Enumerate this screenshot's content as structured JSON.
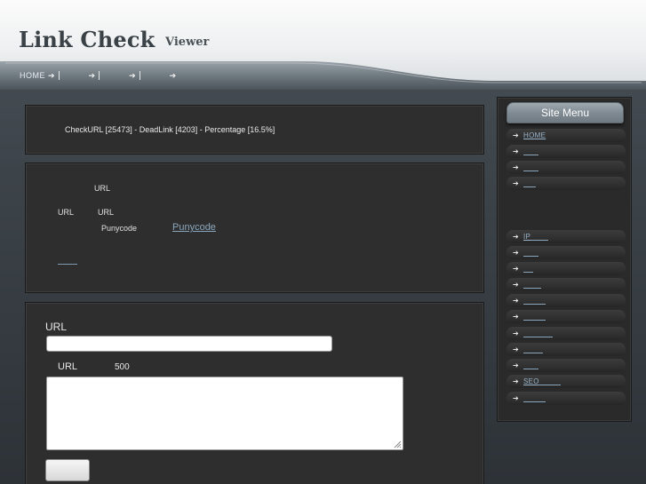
{
  "header": {
    "title": "Link Check",
    "subtitle": "Viewer"
  },
  "nav": {
    "items": [
      {
        "label": "HOME",
        "arrow": "➔"
      },
      {
        "label": "",
        "arrow": "➔"
      },
      {
        "label": "",
        "arrow": "➔"
      },
      {
        "label": "",
        "arrow": "➔"
      }
    ]
  },
  "stats": {
    "text": "CheckURL [25473] - DeadLink [4203] - Percentage [16.5%]"
  },
  "info": {
    "line1": "URL",
    "line2_a": "URL",
    "line2_b": "URL",
    "punycode_label": "Punycode",
    "punycode_link": "Punycode"
  },
  "form": {
    "url_label": "URL",
    "url_value": "",
    "list_label": "URL",
    "list_limit": "500",
    "list_value": "",
    "submit_label": ""
  },
  "sidebar": {
    "title": "Site Menu",
    "arrow": "➔",
    "group1": [
      {
        "label": "HOME"
      },
      {
        "label": ""
      },
      {
        "label": ""
      },
      {
        "label": ""
      }
    ],
    "group2": [
      {
        "label": "IP"
      },
      {
        "label": ""
      },
      {
        "label": ""
      },
      {
        "label": ""
      },
      {
        "label": ""
      },
      {
        "label": ""
      },
      {
        "label": ""
      },
      {
        "label": ""
      },
      {
        "label": ""
      },
      {
        "label": "SEO"
      },
      {
        "label": ""
      }
    ]
  }
}
